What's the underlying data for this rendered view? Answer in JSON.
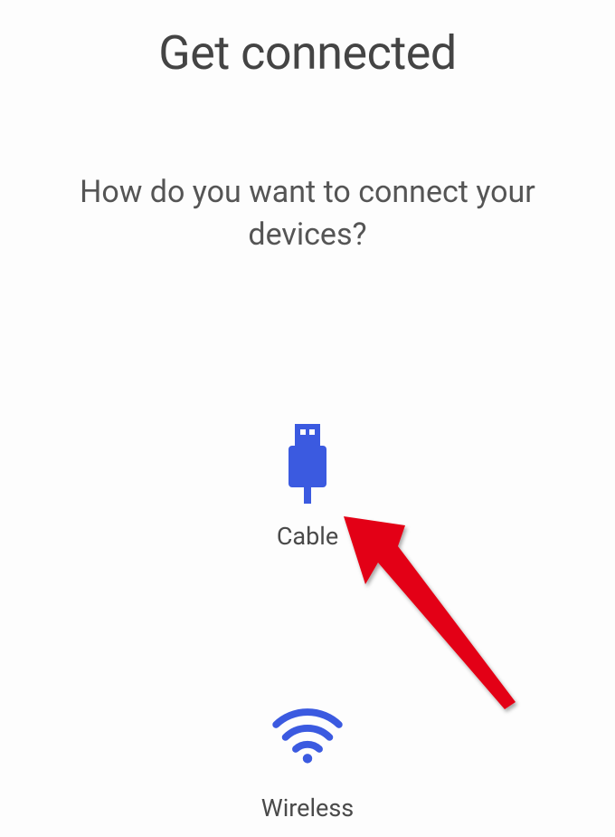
{
  "title": "Get connected",
  "subtitle": "How do you want to connect your devices?",
  "options": {
    "cable": {
      "label": "Cable"
    },
    "wireless": {
      "label": "Wireless"
    }
  },
  "colors": {
    "icon_blue": "#3b5ae0",
    "arrow_red": "#e30613"
  }
}
